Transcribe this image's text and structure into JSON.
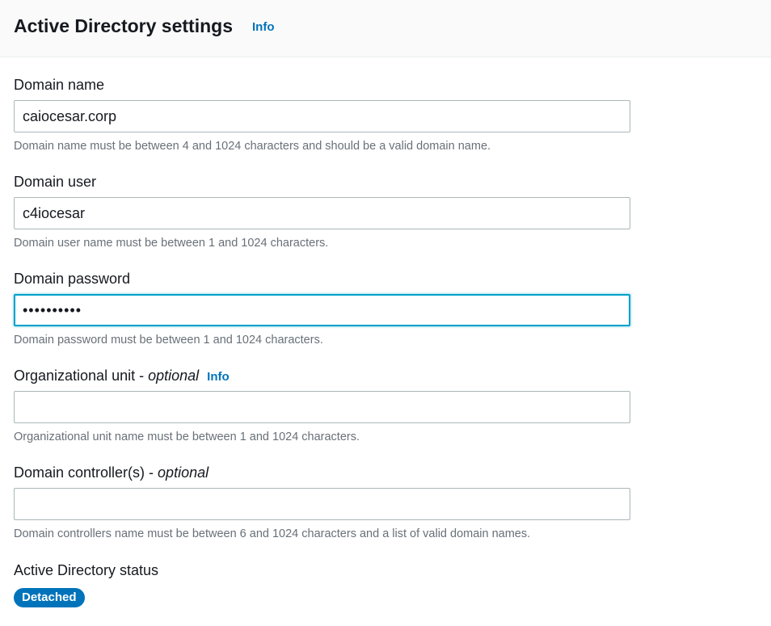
{
  "header": {
    "title": "Active Directory settings",
    "info_label": "Info"
  },
  "fields": {
    "domain_name": {
      "label": "Domain name",
      "value": "caiocesar.corp",
      "hint": "Domain name must be between 4 and 1024 characters and should be a valid domain name."
    },
    "domain_user": {
      "label": "Domain user",
      "value": "c4iocesar",
      "hint": "Domain user name must be between 1 and 1024 characters."
    },
    "domain_password": {
      "label": "Domain password",
      "value": "••••••••••",
      "hint": "Domain password must be between 1 and 1024 characters."
    },
    "organizational_unit": {
      "label": "Organizational unit - ",
      "optional": "optional",
      "info_label": "Info",
      "value": "",
      "hint": "Organizational unit name must be between 1 and 1024 characters."
    },
    "domain_controllers": {
      "label": "Domain controller(s) - ",
      "optional": "optional",
      "value": "",
      "hint": "Domain controllers name must be between 6 and 1024 characters and a list of valid domain names."
    }
  },
  "status": {
    "label": "Active Directory status",
    "badge": "Detached",
    "badge_color": "#0073bb"
  },
  "colors": {
    "link": "#0073bb",
    "focus_border": "#00a1c9",
    "hint_text": "#687078"
  }
}
